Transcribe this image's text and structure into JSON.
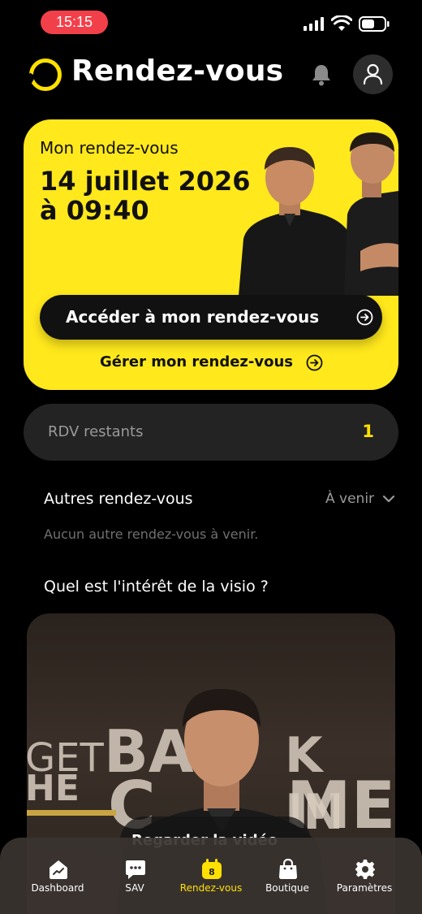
{
  "status_bar": {
    "time": "15:15"
  },
  "header": {
    "title": "Rendez-vous"
  },
  "appointment": {
    "label": "Mon rendez-vous",
    "date_line1": "14 juillet 2026",
    "date_line2": "à 09:40",
    "access_label": "Accéder à mon rendez-vous",
    "manage_label": "Gérer mon rendez-vous"
  },
  "remaining": {
    "label": "RDV restants",
    "count": "1"
  },
  "others": {
    "title": "Autres rendez-vous",
    "filter": "À venir",
    "empty": "Aucun autre rendez-vous à venir."
  },
  "visio": {
    "title": "Quel est l'intérêt de la visio ?",
    "video_text_1": "GET",
    "video_text_2": "BA",
    "video_text_3": "K IN",
    "video_text_4": "HE",
    "video_text_5": "C",
    "video_text_6": "ME",
    "play_label": "Regarder la vidéo"
  },
  "tabs": [
    {
      "label": "Dashboard",
      "icon": "dashboard-icon"
    },
    {
      "label": "SAV",
      "icon": "chat-icon"
    },
    {
      "label": "Rendez-vous",
      "icon": "calendar-icon",
      "badge": "8"
    },
    {
      "label": "Boutique",
      "icon": "shopping-bag-icon"
    },
    {
      "label": "Paramètres",
      "icon": "gear-icon"
    }
  ],
  "colors": {
    "accent": "#ffe000",
    "card_yellow": "#ffe81c",
    "surface": "#232323",
    "status_pill": "#f2404a"
  }
}
